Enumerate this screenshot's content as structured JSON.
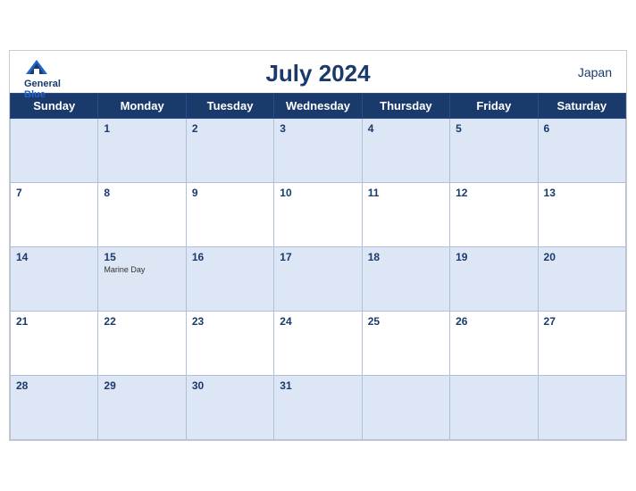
{
  "header": {
    "title": "July 2024",
    "country": "Japan",
    "logo": {
      "line1": "General",
      "line2": "Blue"
    }
  },
  "weekdays": [
    "Sunday",
    "Monday",
    "Tuesday",
    "Wednesday",
    "Thursday",
    "Friday",
    "Saturday"
  ],
  "weeks": [
    [
      {
        "day": "",
        "holiday": ""
      },
      {
        "day": "1",
        "holiday": ""
      },
      {
        "day": "2",
        "holiday": ""
      },
      {
        "day": "3",
        "holiday": ""
      },
      {
        "day": "4",
        "holiday": ""
      },
      {
        "day": "5",
        "holiday": ""
      },
      {
        "day": "6",
        "holiday": ""
      }
    ],
    [
      {
        "day": "7",
        "holiday": ""
      },
      {
        "day": "8",
        "holiday": ""
      },
      {
        "day": "9",
        "holiday": ""
      },
      {
        "day": "10",
        "holiday": ""
      },
      {
        "day": "11",
        "holiday": ""
      },
      {
        "day": "12",
        "holiday": ""
      },
      {
        "day": "13",
        "holiday": ""
      }
    ],
    [
      {
        "day": "14",
        "holiday": ""
      },
      {
        "day": "15",
        "holiday": "Marine Day"
      },
      {
        "day": "16",
        "holiday": ""
      },
      {
        "day": "17",
        "holiday": ""
      },
      {
        "day": "18",
        "holiday": ""
      },
      {
        "day": "19",
        "holiday": ""
      },
      {
        "day": "20",
        "holiday": ""
      }
    ],
    [
      {
        "day": "21",
        "holiday": ""
      },
      {
        "day": "22",
        "holiday": ""
      },
      {
        "day": "23",
        "holiday": ""
      },
      {
        "day": "24",
        "holiday": ""
      },
      {
        "day": "25",
        "holiday": ""
      },
      {
        "day": "26",
        "holiday": ""
      },
      {
        "day": "27",
        "holiday": ""
      }
    ],
    [
      {
        "day": "28",
        "holiday": ""
      },
      {
        "day": "29",
        "holiday": ""
      },
      {
        "day": "30",
        "holiday": ""
      },
      {
        "day": "31",
        "holiday": ""
      },
      {
        "day": "",
        "holiday": ""
      },
      {
        "day": "",
        "holiday": ""
      },
      {
        "day": "",
        "holiday": ""
      }
    ]
  ]
}
